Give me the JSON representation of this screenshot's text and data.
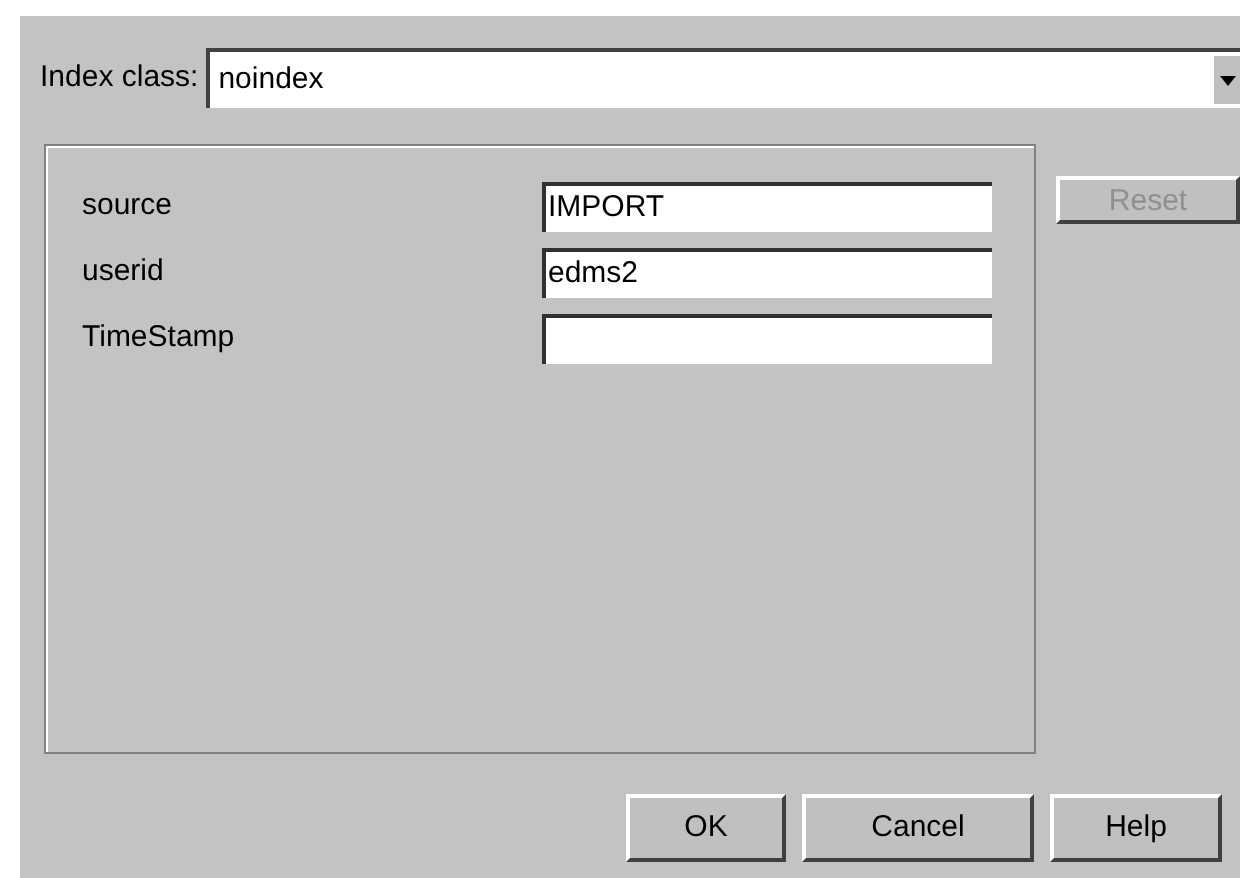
{
  "index_class": {
    "label": "Index class:",
    "value": "noindex"
  },
  "fields": [
    {
      "label": "source",
      "value": "IMPORT"
    },
    {
      "label": "userid",
      "value": "edms2"
    },
    {
      "label": "TimeStamp"
    }
  ],
  "reset_button": {
    "label": "Reset",
    "disabled": true
  },
  "buttons": [
    {
      "label": "OK"
    },
    {
      "label": "Cancel"
    },
    {
      "label": "Help"
    }
  ]
}
